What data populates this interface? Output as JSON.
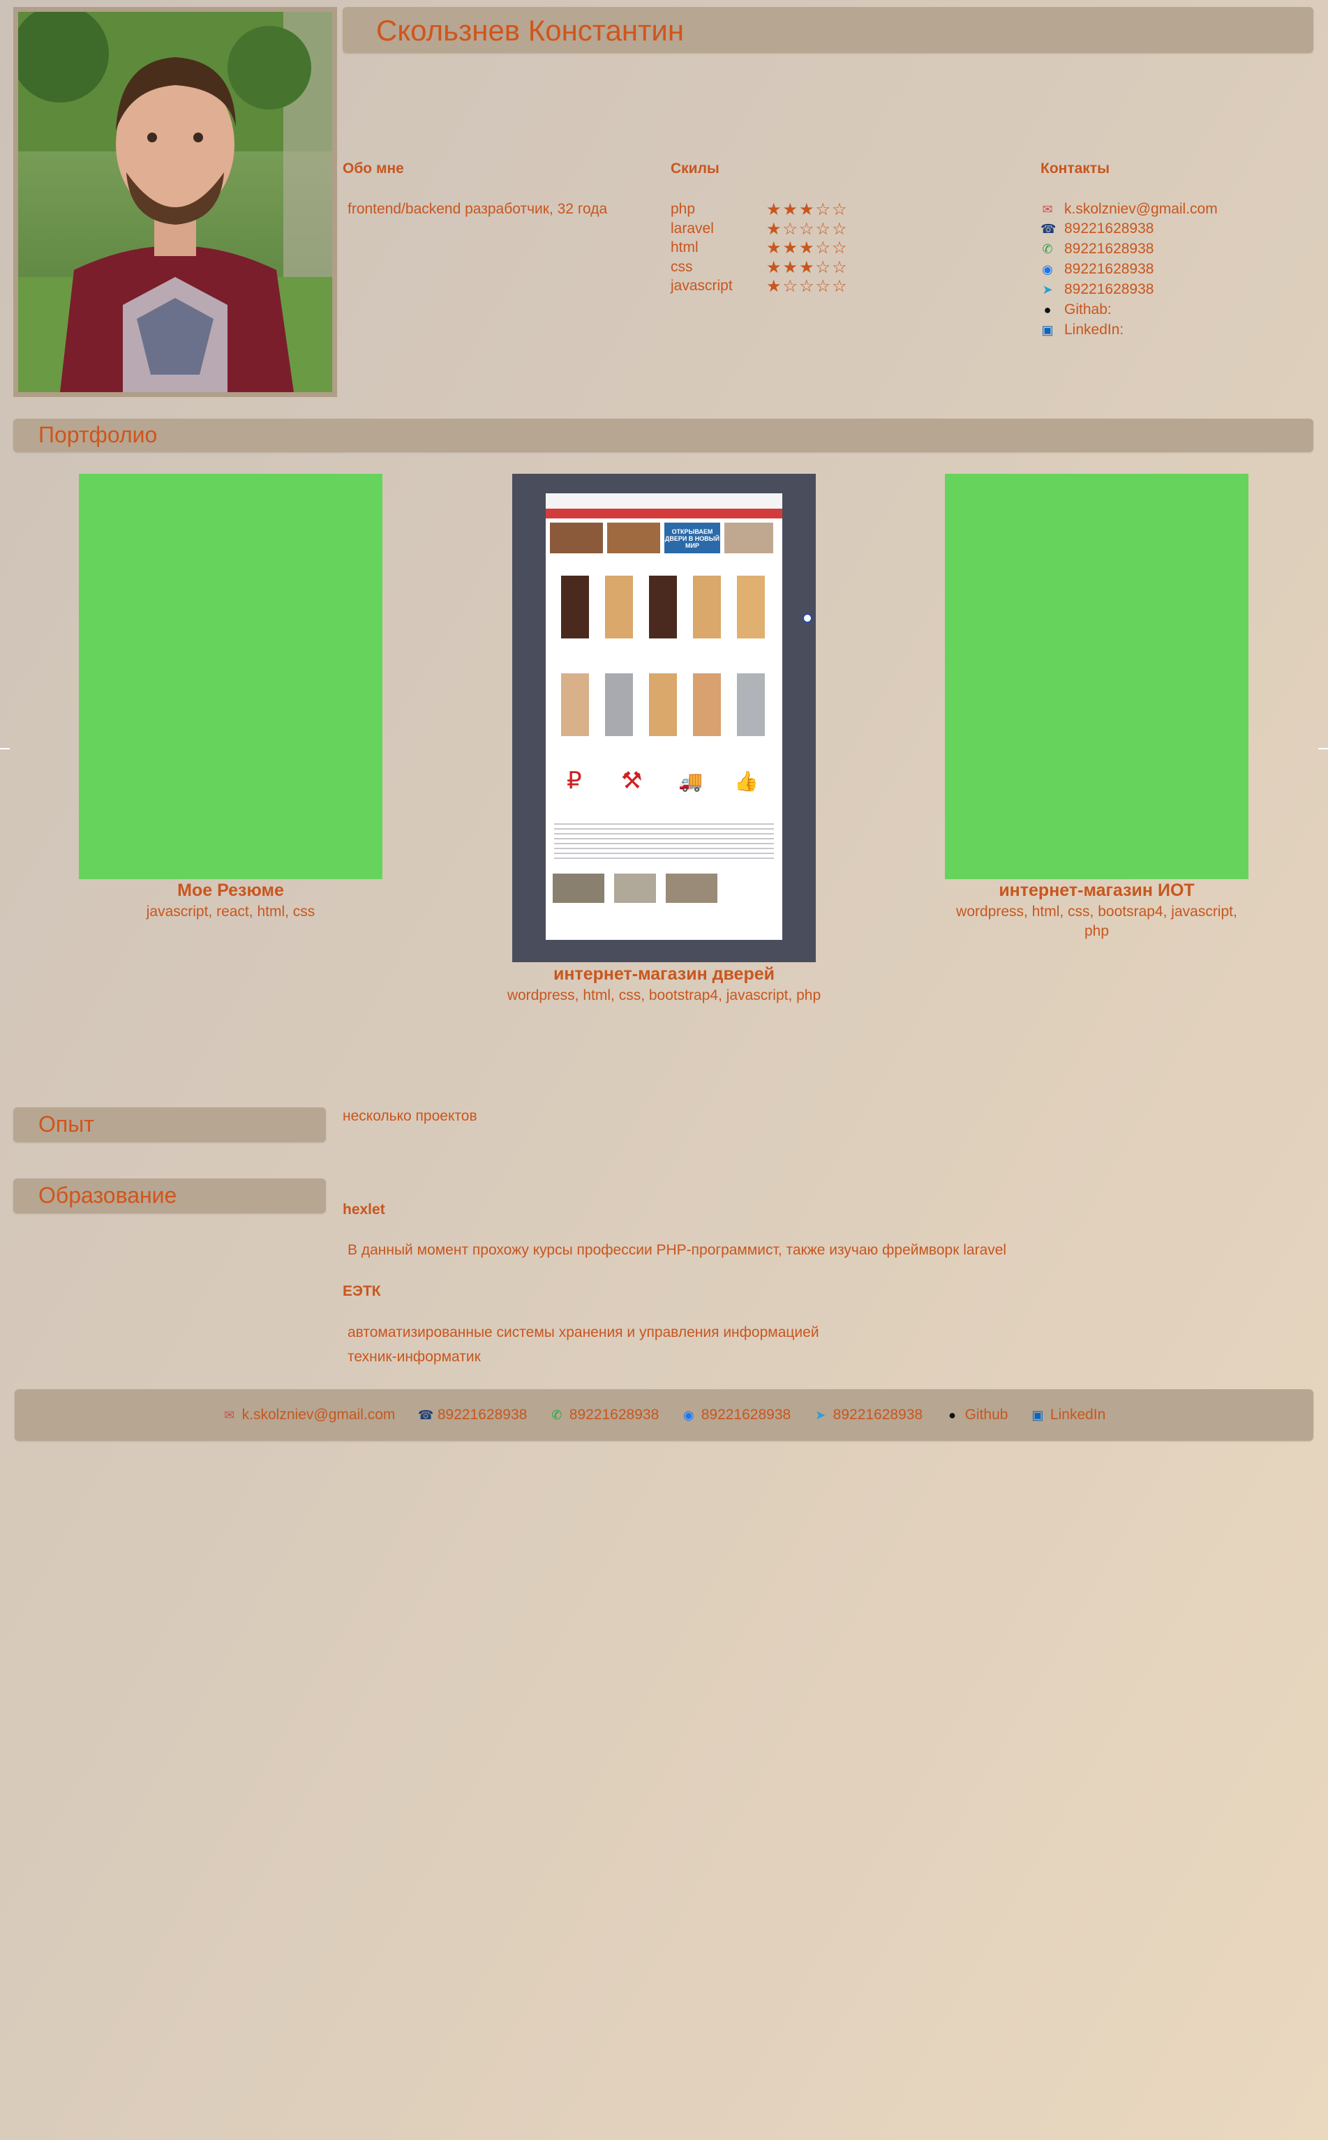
{
  "header": {
    "name": "Скользнев Константин"
  },
  "about": {
    "title": "Обо мне",
    "text": "frontend/backend разработчик, 32 года"
  },
  "skills": {
    "title": "Скилы",
    "items": [
      {
        "name": "php",
        "stars": "★★★☆☆",
        "rating": 3
      },
      {
        "name": "laravel",
        "stars": "★☆☆☆☆",
        "rating": 1
      },
      {
        "name": "html",
        "stars": "★★★☆☆",
        "rating": 3
      },
      {
        "name": "css",
        "stars": "★★★☆☆",
        "rating": 3
      },
      {
        "name": "javascript",
        "stars": "★☆☆☆☆",
        "rating": 1
      }
    ]
  },
  "contacts": {
    "title": "Контакты",
    "items": [
      {
        "icon": "mail-icon",
        "glyph": "✉",
        "text": "k.skolzniev@gmail.com"
      },
      {
        "icon": "phone-icon",
        "glyph": "☎",
        "text": "89221628938"
      },
      {
        "icon": "whatsapp-icon",
        "glyph": "✆",
        "text": "89221628938"
      },
      {
        "icon": "messenger-icon",
        "glyph": "◉",
        "text": "89221628938"
      },
      {
        "icon": "telegram-icon",
        "glyph": "➤",
        "text": "89221628938"
      },
      {
        "icon": "github-icon",
        "glyph": "●",
        "text": "Githab:"
      },
      {
        "icon": "linkedin-icon",
        "glyph": "▣",
        "text": "LinkedIn:"
      }
    ]
  },
  "portfolio": {
    "title": "Портфолио",
    "projects": [
      {
        "title": "Мое Резюме",
        "tech": "javascript, react, html, css"
      },
      {
        "title": "интернет-магазин дверей",
        "tech": "wordpress, html, css, bootstrap4, javascript, php",
        "preview": {
          "banner": "ОТКРЫВАЕМ ДВЕРИ В НОВЫЙ МИР",
          "icons": [
            "₽",
            "⚒",
            "🚚",
            "👍"
          ]
        }
      },
      {
        "title": "интернет-магазин ИОТ",
        "tech": "wordpress, html, css, bootsrap4, javascript, php"
      }
    ]
  },
  "experience": {
    "title": "Опыт",
    "text": "несколько проектов"
  },
  "education": {
    "title": "Образование",
    "items": [
      {
        "name": "hexlet",
        "lines": [
          "В данный момент прохожу курсы профессии PHP-программист, также изучаю фреймворк laravel"
        ]
      },
      {
        "name": "ЕЭТК",
        "lines": [
          "автоматизированные системы хранения и управления информацией",
          "техник-информатик"
        ]
      }
    ]
  },
  "footer": {
    "items": [
      {
        "icon": "mail-icon",
        "glyph": "✉",
        "text": "k.skolzniev@gmail.com"
      },
      {
        "icon": "phone-icon",
        "glyph": "☎",
        "text": "89221628938"
      },
      {
        "icon": "whatsapp-icon",
        "glyph": "✆",
        "text": "89221628938"
      },
      {
        "icon": "messenger-icon",
        "glyph": "◉",
        "text": "89221628938"
      },
      {
        "icon": "telegram-icon",
        "glyph": "➤",
        "text": "89221628938"
      },
      {
        "icon": "github-icon",
        "glyph": "●",
        "text": "Github"
      },
      {
        "icon": "linkedin-icon",
        "glyph": "▣",
        "text": "LinkedIn"
      }
    ]
  },
  "colors": {
    "accent": "#c8561f",
    "bar": "#b7a691",
    "thumb": "#66d45c",
    "preview_bg": "#4a4d5c"
  }
}
